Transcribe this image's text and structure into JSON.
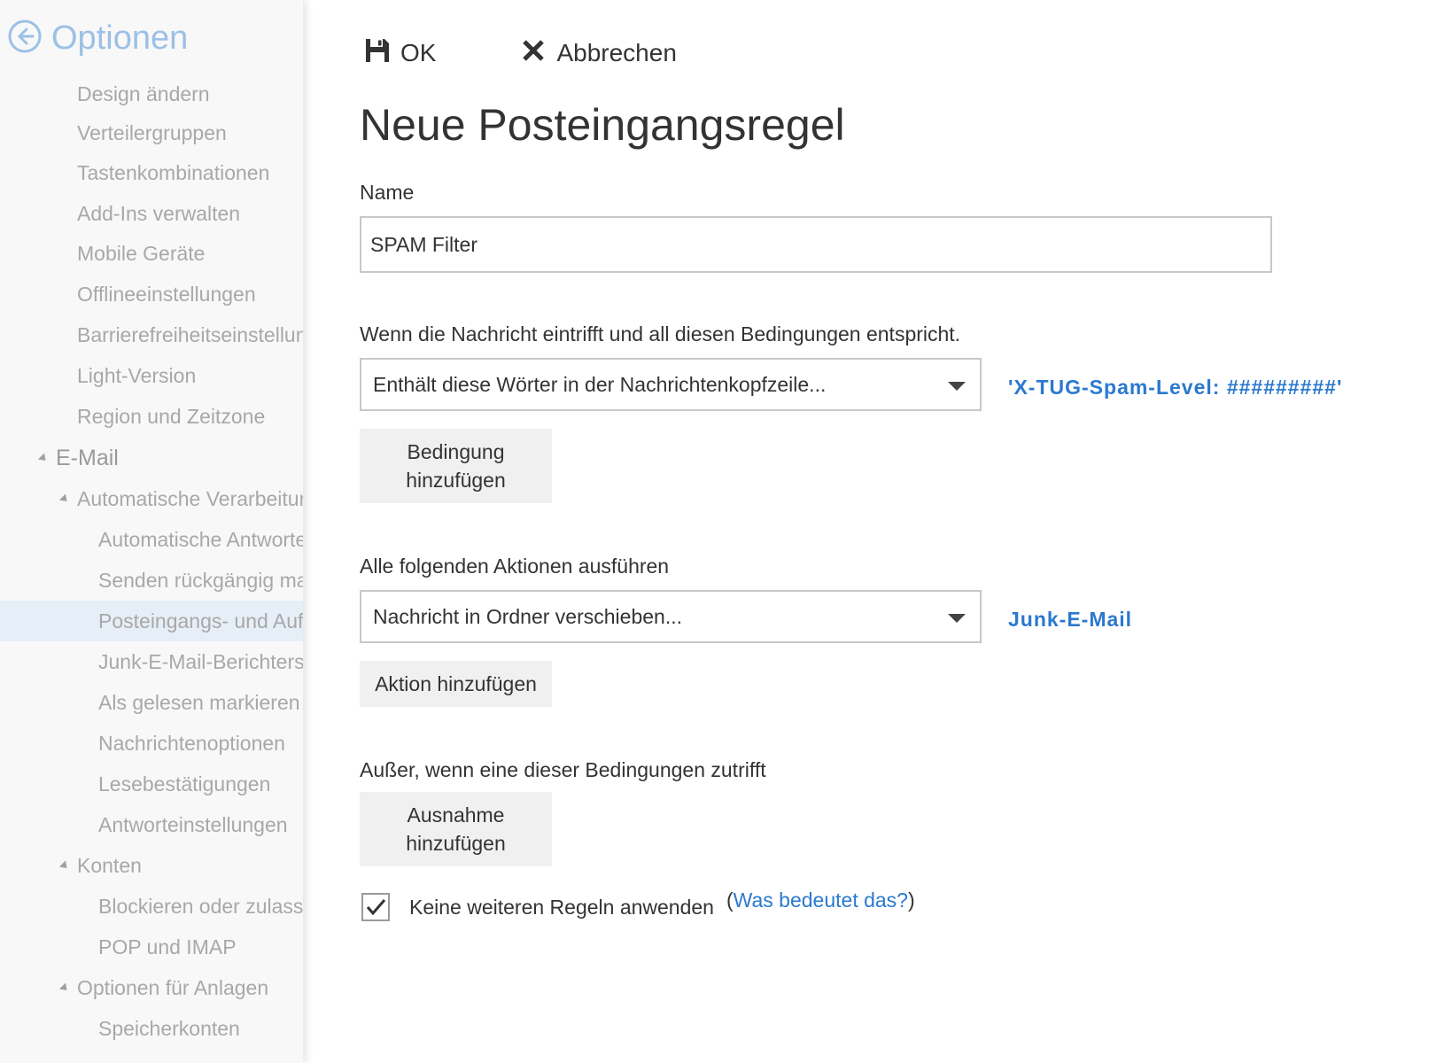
{
  "sidebar": {
    "title": "Optionen",
    "items": [
      {
        "label": "Design ändern"
      },
      {
        "label": "Verteilergruppen"
      },
      {
        "label": "Tastenkombinationen"
      },
      {
        "label": "Add-Ins verwalten"
      },
      {
        "label": "Mobile Geräte"
      },
      {
        "label": "Offlineeinstellungen"
      },
      {
        "label": "Barrierefreiheitseinstellungen"
      },
      {
        "label": "Light-Version"
      },
      {
        "label": "Region und Zeitzone"
      }
    ],
    "email_section": "E-Mail",
    "auto_processing": "Automatische Verarbeitung",
    "auto_items": [
      {
        "label": "Automatische Antworten"
      },
      {
        "label": "Senden rückgängig machen"
      },
      {
        "label": "Posteingangs- und Aufräumregeln"
      },
      {
        "label": "Junk-E-Mail-Berichterstattung"
      },
      {
        "label": "Als gelesen markieren"
      },
      {
        "label": "Nachrichtenoptionen"
      },
      {
        "label": "Lesebestätigungen"
      },
      {
        "label": "Antworteinstellungen"
      }
    ],
    "accounts": "Konten",
    "account_items": [
      {
        "label": "Blockieren oder zulassen"
      },
      {
        "label": "POP und IMAP"
      }
    ],
    "attachments": "Optionen für Anlagen",
    "attachment_items": [
      {
        "label": "Speicherkonten"
      }
    ]
  },
  "toolbar": {
    "ok_label": "OK",
    "cancel_label": "Abbrechen"
  },
  "form": {
    "title": "Neue Posteingangsregel",
    "name_label": "Name",
    "name_value": "SPAM Filter",
    "conditions_label": "Wenn die Nachricht eintrifft und all diesen Bedingungen entspricht.",
    "condition_select": "Enthält diese Wörter in der Nachrichtenkopfzeile...",
    "condition_value": "'X-TUG-Spam-Level: #########'",
    "add_condition": "Bedingung hinzufügen",
    "actions_label": "Alle folgenden Aktionen ausführen",
    "action_select": "Nachricht in Ordner verschieben...",
    "action_value": "Junk-E-Mail",
    "add_action": "Aktion hinzufügen",
    "exceptions_label": "Außer, wenn eine dieser Bedingungen zutrifft",
    "add_exception": "Ausnahme hinzufügen",
    "stop_rules_label": "Keine weiteren Regeln anwenden",
    "stop_rules_checked": true,
    "help_open": "(",
    "help_link": "Was bedeutet das?",
    "help_close": ")"
  },
  "colors": {
    "accent": "#2b79cf",
    "sidebar_title": "#9cc0e6",
    "selected_bg": "#e6eef7"
  }
}
